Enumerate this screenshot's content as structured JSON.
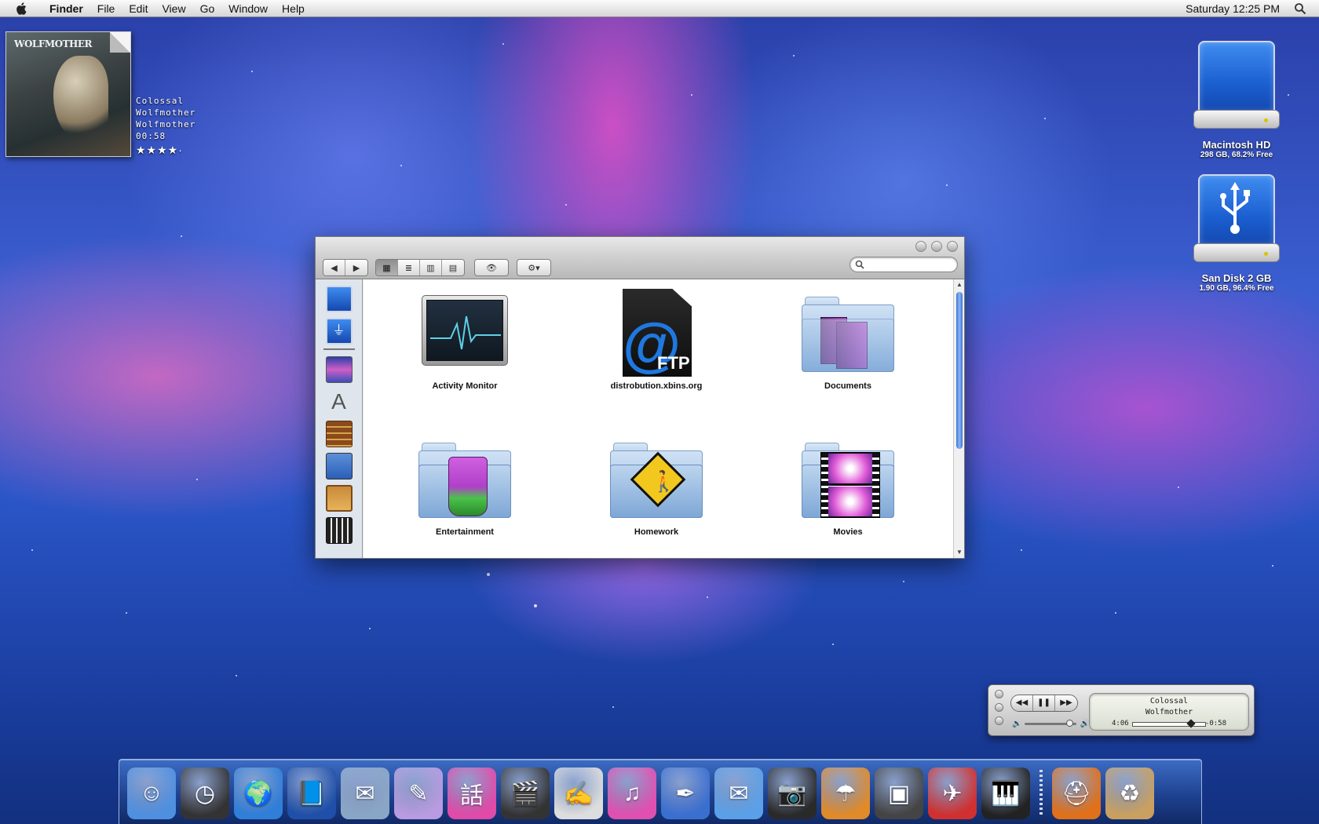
{
  "menubar": {
    "app_name": "Finder",
    "items": [
      "File",
      "Edit",
      "View",
      "Go",
      "Window",
      "Help"
    ],
    "clock": "Saturday 12:25 PM"
  },
  "now_playing": {
    "album_art_text": "WOLFMOTHER",
    "track": "Colossal",
    "artist": "Wolfmother",
    "album": "Wolfmother",
    "time": "00:58",
    "rating": "★★★★·",
    "rating_value": 4
  },
  "desktop": {
    "drives": [
      {
        "name": "Macintosh HD",
        "info": "298 GB, 68.2% Free",
        "icon": "hard-drive-icon"
      },
      {
        "name": "San Disk 2 GB",
        "info": "1.90 GB, 96.4% Free",
        "icon": "usb-drive-icon"
      }
    ]
  },
  "finder": {
    "toolbar": {
      "back": "◀",
      "forward": "▶",
      "view_icons": "▦",
      "view_list": "≣",
      "view_columns": "▥",
      "view_coverflow": "▤",
      "quicklook": "👁",
      "action": "⚙▾",
      "search_placeholder": ""
    },
    "sidebar": [
      "hard-drive-icon",
      "usb-drive-icon",
      "desktop-icon",
      "applications-icon",
      "library-icon",
      "dvd-icon",
      "pictures-icon",
      "movies-icon"
    ],
    "items": [
      {
        "label": "Activity Monitor",
        "icon": "activity-monitor-icon"
      },
      {
        "label": "distrobution.xbins.org",
        "icon": "ftp-server-icon"
      },
      {
        "label": "Documents",
        "icon": "documents-folder-icon"
      },
      {
        "label": "Entertainment",
        "icon": "entertainment-folder-icon"
      },
      {
        "label": "Homework",
        "icon": "homework-folder-icon"
      },
      {
        "label": "Movies",
        "icon": "movies-folder-icon"
      }
    ],
    "ftp_text": "FTP",
    "ftp_at": "@"
  },
  "itunes": {
    "track": "Colossal",
    "artist": "Wolfmother",
    "elapsed": "4:06",
    "remaining": "-0:58",
    "rewind": "◀◀",
    "pause": "❚❚",
    "forward": "▶▶",
    "progress": 0.81
  },
  "dock": {
    "items": [
      {
        "name": "finder-icon",
        "glyph": "☺",
        "color": "#4f8fe0"
      },
      {
        "name": "dashboard-icon",
        "glyph": "◷",
        "color": "#333333"
      },
      {
        "name": "network-globe-icon",
        "glyph": "🌍",
        "color": "#2f7ed8"
      },
      {
        "name": "address-book-icon",
        "glyph": "📘",
        "color": "#1f4fa8"
      },
      {
        "name": "mail-stamp-icon",
        "glyph": "✉",
        "color": "#8aa6c6"
      },
      {
        "name": "textedit-icon",
        "glyph": "✎",
        "color": "#b89be0"
      },
      {
        "name": "ichat-icon",
        "glyph": "話",
        "color": "#e04aa8"
      },
      {
        "name": "imovie-icon",
        "glyph": "🎬",
        "color": "#333333"
      },
      {
        "name": "pages-icon",
        "glyph": "✍",
        "color": "#dddddd"
      },
      {
        "name": "itunes-icon",
        "glyph": "♫",
        "color": "#e050b0"
      },
      {
        "name": "feather-icon",
        "glyph": "✒",
        "color": "#3a6fd0"
      },
      {
        "name": "mail-icon",
        "glyph": "✉",
        "color": "#5aa0e8"
      },
      {
        "name": "camera-icon",
        "glyph": "📷",
        "color": "#2a2a2a"
      },
      {
        "name": "umbrella-icon",
        "glyph": "☂",
        "color": "#e08a2a"
      },
      {
        "name": "photo-booth-icon",
        "glyph": "▣",
        "color": "#444444"
      },
      {
        "name": "airmail-icon",
        "glyph": "✈",
        "color": "#d03030"
      },
      {
        "name": "piano-icon",
        "glyph": "🎹",
        "color": "#222222"
      },
      {
        "name": "lifejacket-icon",
        "glyph": "⛑",
        "color": "#e0701a"
      },
      {
        "name": "trash-icon",
        "glyph": "♻",
        "color": "#c9a060"
      }
    ]
  }
}
